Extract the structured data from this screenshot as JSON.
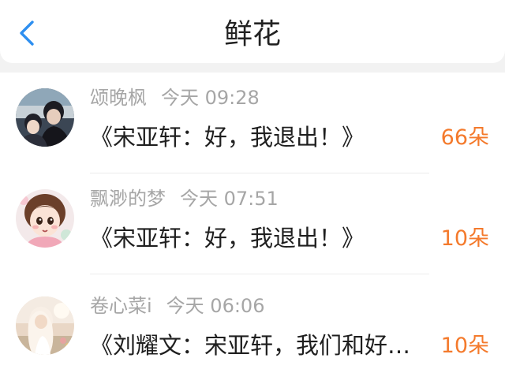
{
  "header": {
    "title": "鲜花",
    "back_icon": "chevron-left-icon"
  },
  "colors": {
    "accent": "#2e8ff0",
    "count": "#f47a2c",
    "meta_text": "#a6a6a6",
    "body_text": "#1f1f1f"
  },
  "rows": [
    {
      "username": "颂晚枫",
      "time": "今天 09:28",
      "title": "《宋亚轩：好，我退出！》",
      "count": "66朵"
    },
    {
      "username": "飘渺的梦",
      "time": "今天 07:51",
      "title": "《宋亚轩：好，我退出！》",
      "count": "10朵"
    },
    {
      "username": "卷心菜i",
      "time": "今天 06:06",
      "title": "《刘耀文：宋亚轩，我们和好…",
      "count": "10朵"
    }
  ]
}
